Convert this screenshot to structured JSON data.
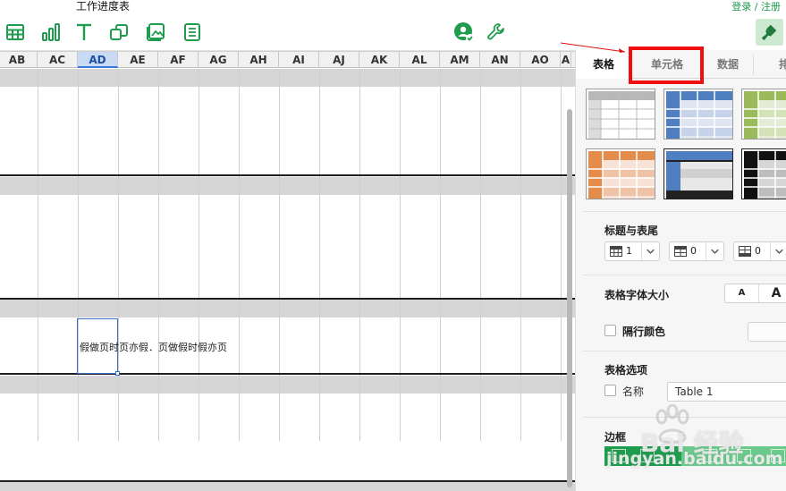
{
  "app": {
    "document_title": "工作进度表",
    "login_link": "登录 / 注册"
  },
  "toolbar": {
    "left_icons": [
      "table-icon",
      "chart-icon",
      "text-icon",
      "shape-icon",
      "media-icon",
      "comment-icon"
    ],
    "right_icons": [
      "collaborate-icon",
      "wrench-icon",
      "format-brush-icon"
    ],
    "accent_color": "#1a9a4a"
  },
  "sheet": {
    "columns": [
      "AB",
      "AC",
      "AD",
      "AE",
      "AF",
      "AG",
      "AH",
      "AI",
      "AJ",
      "AK",
      "AL",
      "AM",
      "AN",
      "AO",
      "A"
    ],
    "selected_column": "AD",
    "selected_cell_text": "假做页时页亦假．页做假时假亦页"
  },
  "panel": {
    "tabs": [
      {
        "label": "表格",
        "active": false
      },
      {
        "label": "单元格",
        "active": true
      },
      {
        "label": "数据",
        "active": false
      },
      {
        "label": "排",
        "active": false
      }
    ],
    "table_styles": [
      "gray-style",
      "blue-style",
      "green-style",
      "orange-style",
      "navy-style",
      "black-style"
    ],
    "header_footer": {
      "label": "标题与表尾",
      "steppers": [
        {
          "icon": "header-rows-icon",
          "value": "1"
        },
        {
          "icon": "header-columns-icon",
          "value": "0"
        },
        {
          "icon": "footer-rows-icon",
          "value": "0"
        }
      ]
    },
    "font_size": {
      "label": "表格字体大小",
      "smaller": "A",
      "larger": "A"
    },
    "alternating_rows": {
      "label": "隔行颜色"
    },
    "table_options": {
      "label": "表格选项",
      "name_label": "名称",
      "name_value": "Table 1"
    },
    "gridlines_label": "边框"
  },
  "watermark": {
    "text": "Bai 经验",
    "sub": "jingyan.baidu.com"
  }
}
